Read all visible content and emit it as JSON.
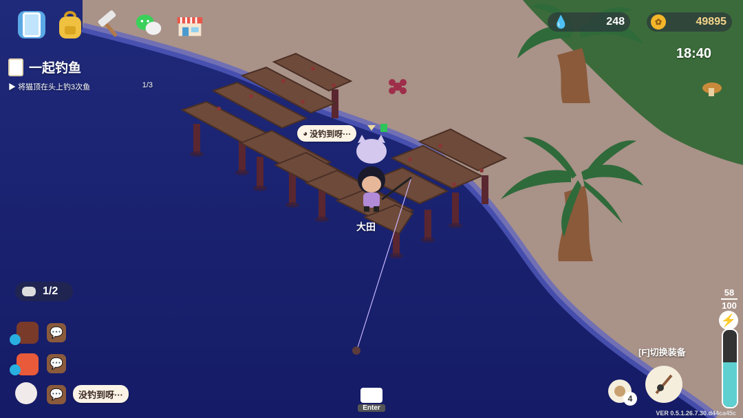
{
  "toolbar": {
    "items": [
      {
        "icon": "phone-icon"
      },
      {
        "icon": "backpack-icon"
      },
      {
        "icon": "hammer-icon"
      },
      {
        "icon": "wechat-icon"
      },
      {
        "icon": "shop-icon"
      }
    ]
  },
  "quest": {
    "title": "一起钓鱼",
    "objective": "将猫顶在头上钓3次鱼",
    "progress": "1/3"
  },
  "currency": {
    "water": "248",
    "coins": "49895"
  },
  "time": "18:40",
  "player": {
    "name": "大田",
    "speech": "没钓到呀···"
  },
  "party": {
    "count": "1/2"
  },
  "chat": {
    "last_message": "没钓到呀···"
  },
  "equipment": {
    "switch_label": "[F]切换装备",
    "bait_count": "4"
  },
  "energy": {
    "current": "58",
    "max": "100",
    "level": 0.58
  },
  "hint": {
    "key": "Enter"
  },
  "version": "VER 0.5.1.26.7.30.d44ca45c",
  "colors": {
    "water": "#1a2070",
    "sand": "#a99288",
    "grass": "#3b6b3a",
    "energy": "#5fd0d0"
  }
}
